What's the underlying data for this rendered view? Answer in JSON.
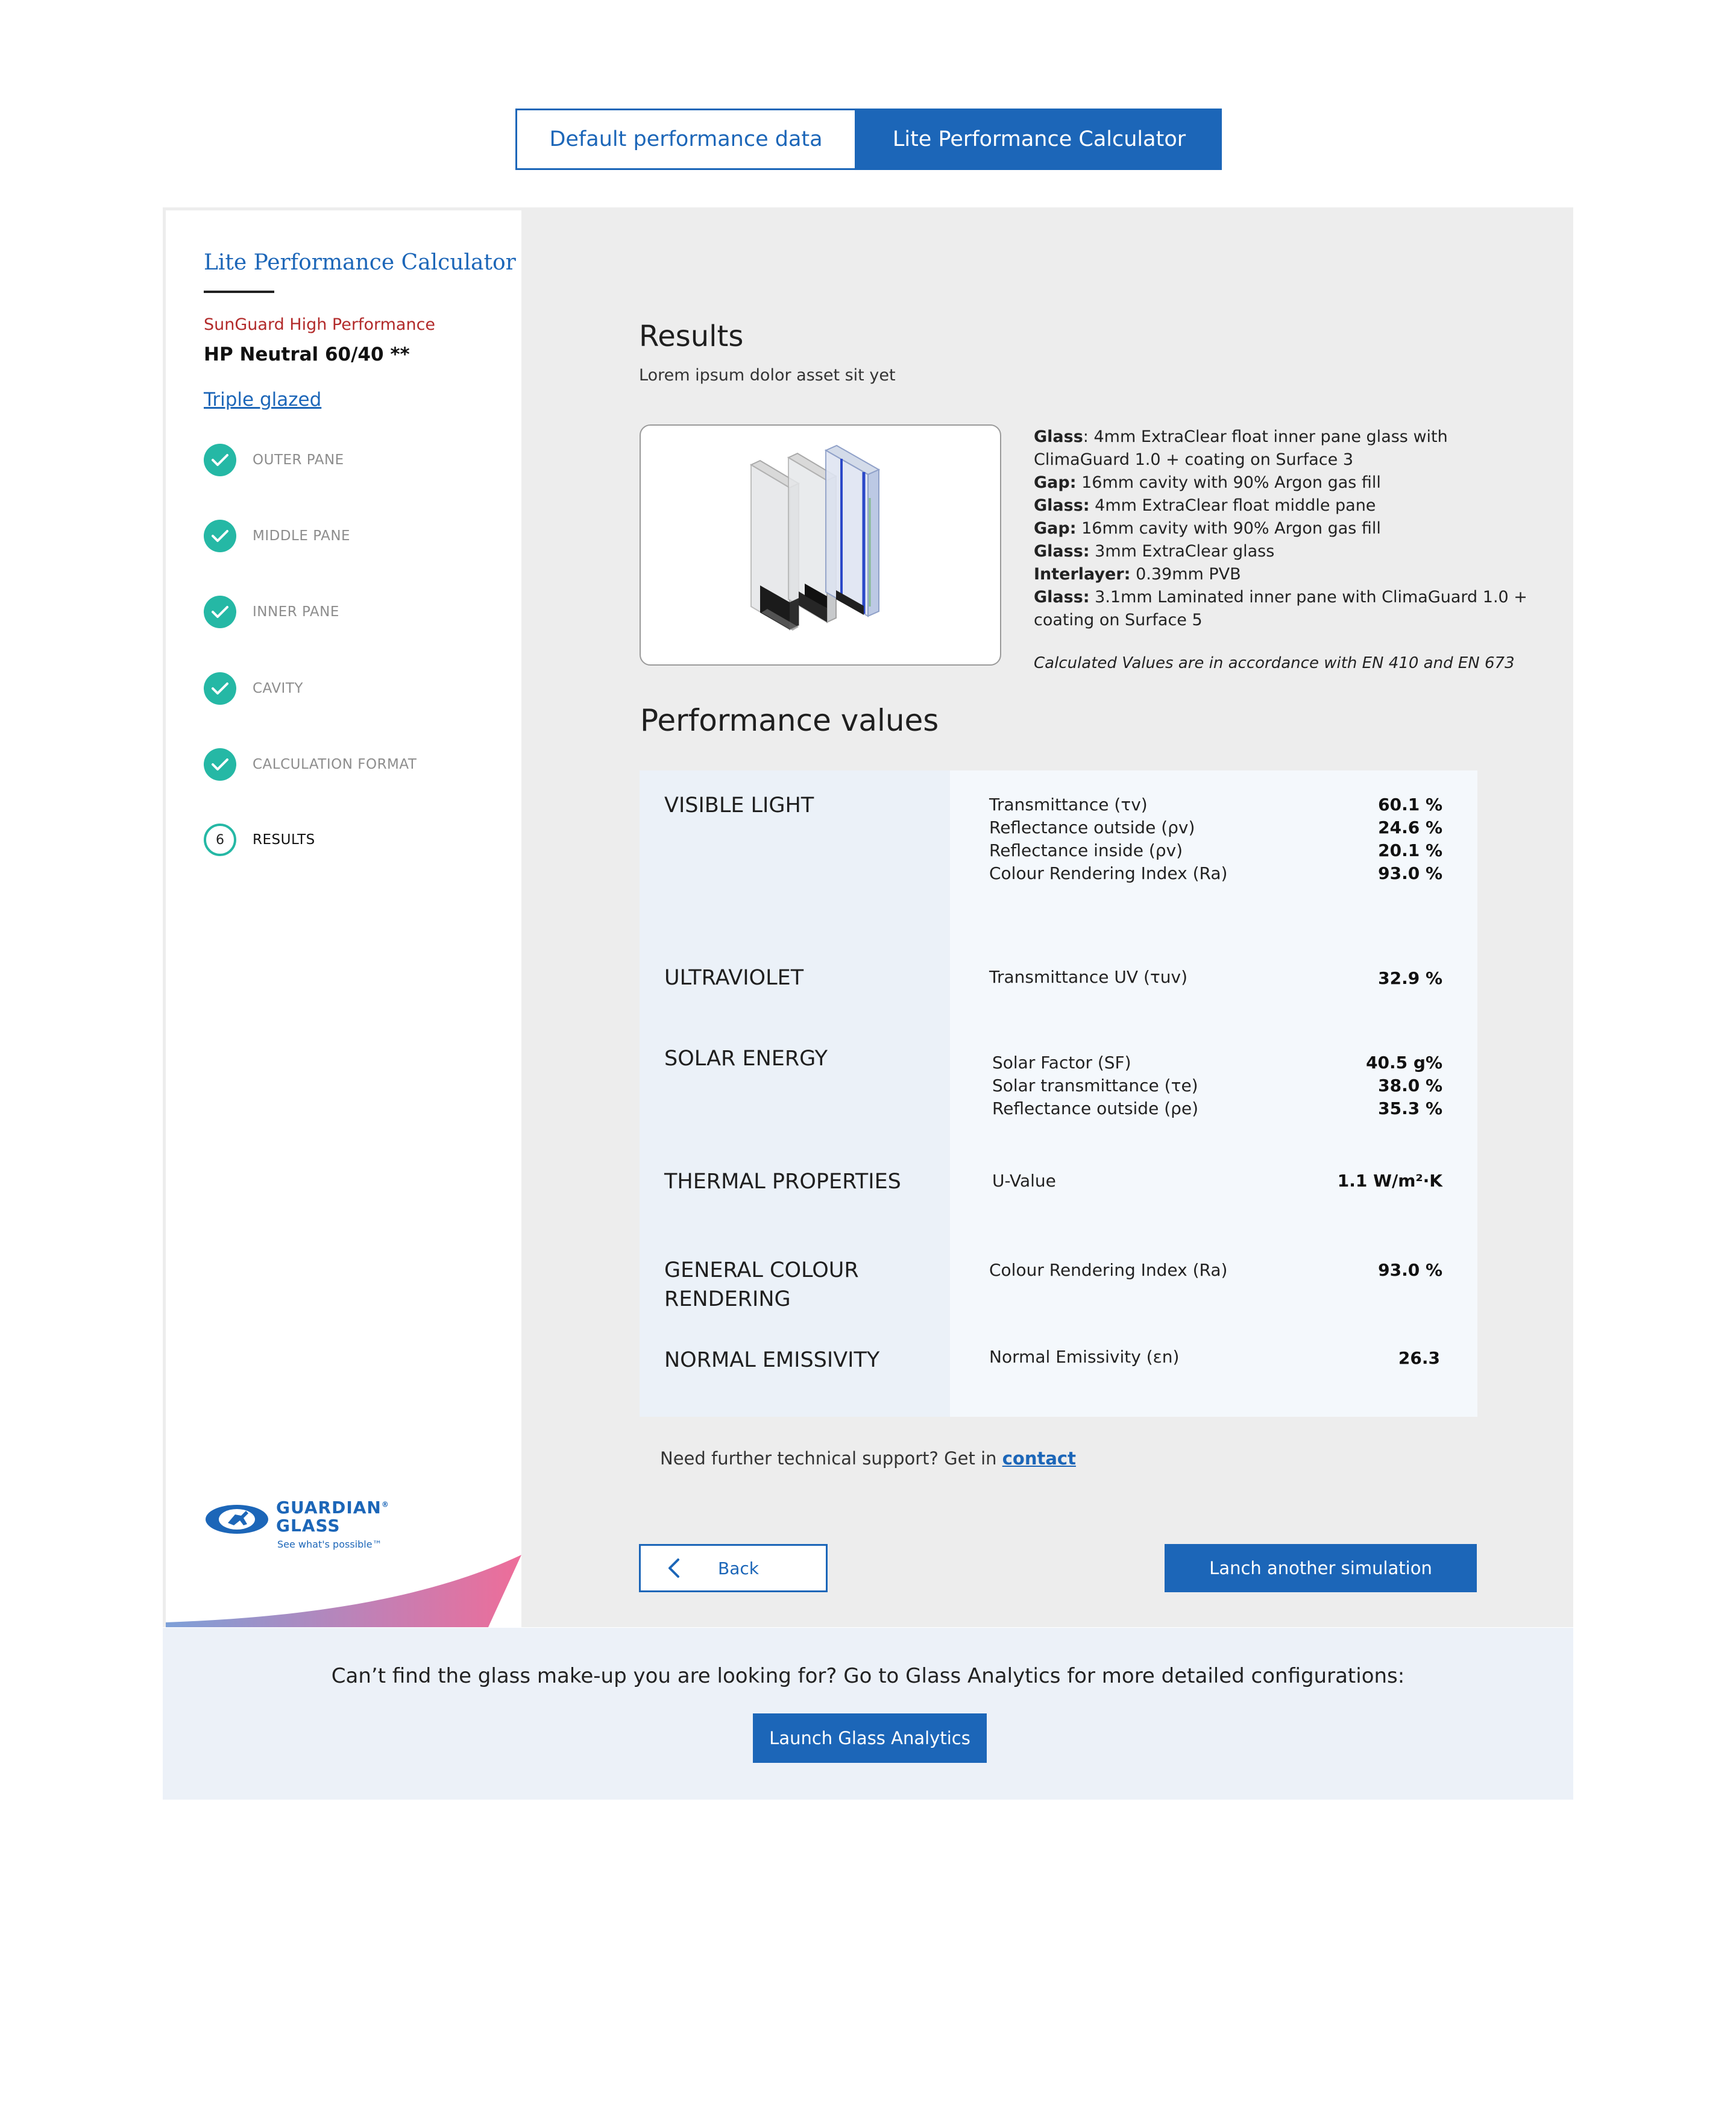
{
  "tabs": [
    {
      "label": "Default performance data",
      "active": false
    },
    {
      "label": "Lite Performance Calculator",
      "active": true
    }
  ],
  "sidebar": {
    "title": "Lite Performance Calculator",
    "brand": "SunGuard High Performance",
    "product": "HP Neutral 60/40 **",
    "glazing_link": "Triple glazed",
    "steps": [
      {
        "label": "OUTER PANE",
        "status": "done"
      },
      {
        "label": "MIDDLE PANE",
        "status": "done"
      },
      {
        "label": "INNER PANE",
        "status": "done"
      },
      {
        "label": "CAVITY",
        "status": "done"
      },
      {
        "label": "CALCULATION FORMAT",
        "status": "done"
      },
      {
        "label": "RESULTS",
        "status": "current",
        "number": "6"
      }
    ],
    "logo": {
      "line1": "GUARDIAN",
      "registered": "®",
      "line2": "GLASS",
      "tagline": "See what's possible™"
    },
    "colors": {
      "accent": "#1c66b8",
      "check": "#25b8a5",
      "brand_red": "#b22a2a"
    }
  },
  "results": {
    "title": "Results",
    "subtitle": "Lorem ipsum dolor asset sit yet",
    "image_icon": "triple-glazed-unit-illustration",
    "composition": [
      {
        "key": "Glass",
        "sep": ": ",
        "value": "4mm ExtraClear float inner pane glass with ClimaGuard 1.0 + coating on Surface 3"
      },
      {
        "key": "Gap:",
        "sep": " ",
        "value": "16mm cavity with 90% Argon gas fill"
      },
      {
        "key": "Glass:",
        "sep": " ",
        "value": "4mm ExtraClear float middle pane"
      },
      {
        "key": "Gap:",
        "sep": " ",
        "value": "16mm cavity with 90% Argon gas fill"
      },
      {
        "key": "Glass:",
        "sep": " ",
        "value": "3mm ExtraClear glass"
      },
      {
        "key": "Interlayer:",
        "sep": " ",
        "value": "0.39mm PVB"
      },
      {
        "key": "Glass:",
        "sep": " ",
        "value": "3.1mm Laminated inner pane with ClimaGuard 1.0 + coating on Surface 5"
      }
    ],
    "note": "Calculated Values are in accordance with EN 410 and EN 673"
  },
  "performance": {
    "title": "Performance values",
    "groups": [
      {
        "category": "VISIBLE LIGHT",
        "rows": [
          {
            "label": "Transmittance (τv)",
            "value": "60.1 %"
          },
          {
            "label": "Reflectance outside (ρv)",
            "value": "24.6 %"
          },
          {
            "label": "Reflectance inside (ρv)",
            "value": "20.1 %"
          },
          {
            "label": "Colour Rendering Index (Ra)",
            "value": "93.0 %"
          }
        ]
      },
      {
        "category": "ULTRAVIOLET",
        "rows": [
          {
            "label": "Transmittance UV (τuv)",
            "value": "32.9 %"
          }
        ]
      },
      {
        "category": "SOLAR ENERGY",
        "rows": [
          {
            "label": "Solar Factor (SF)",
            "value": "40.5 g%"
          },
          {
            "label": "Solar transmittance (τe)",
            "value": "38.0 %"
          },
          {
            "label": "Reflectance outside (ρe)",
            "value": "35.3 %"
          }
        ]
      },
      {
        "category": "THERMAL PROPERTIES",
        "rows": [
          {
            "label": "U-Value",
            "value": "1.1 W/m²·K"
          }
        ]
      },
      {
        "category": "GENERAL COLOUR RENDERING",
        "rows": [
          {
            "label": "Colour Rendering Index (Ra)",
            "value": "93.0 %"
          }
        ]
      },
      {
        "category": "NORMAL EMISSIVITY",
        "rows": [
          {
            "label": "Normal Emissivity (εn)",
            "value": "26.3"
          }
        ]
      }
    ]
  },
  "support": {
    "text": "Need further technical support? Get in ",
    "link": "contact"
  },
  "actions": {
    "back": "Back",
    "launch_simulation": "Lanch another simulation"
  },
  "bottom": {
    "text": "Can’t find the glass make-up you are looking for? Go to Glass Analytics for more detailed configurations:",
    "button": "Launch Glass Analytics"
  }
}
